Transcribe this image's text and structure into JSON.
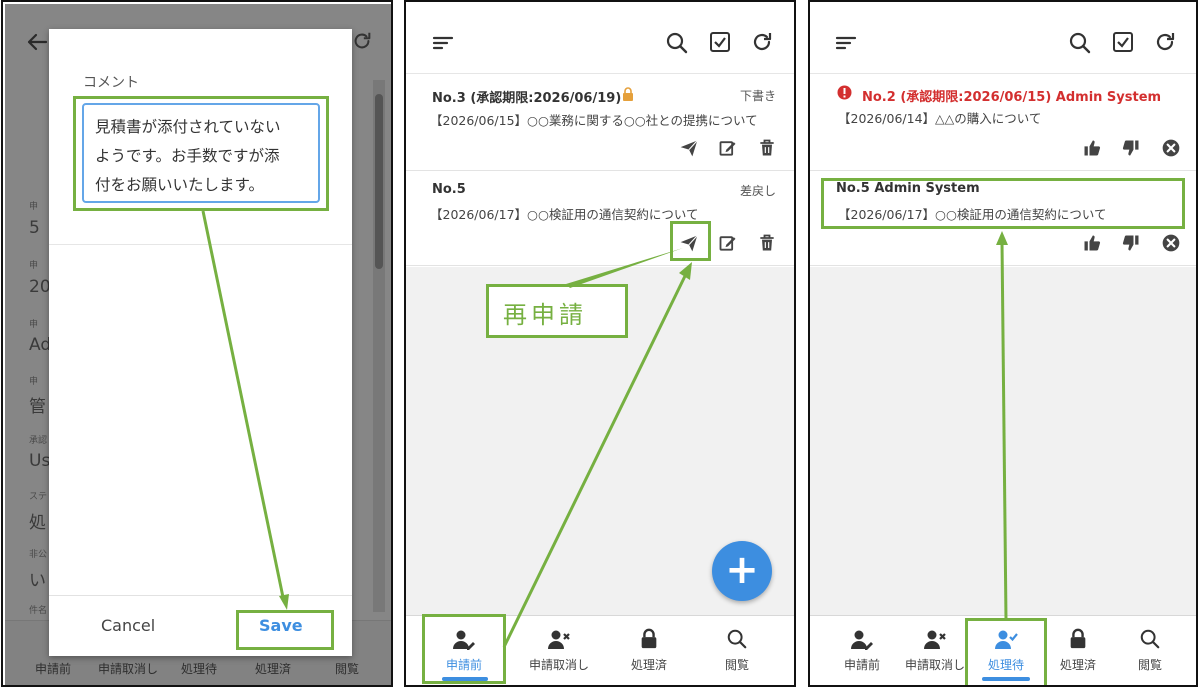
{
  "panel1": {
    "dialog": {
      "label": "コメント",
      "comment_lines": [
        "見積書が添付されていない",
        "ようです。お手数ですが添",
        "付をお願いいたします。"
      ],
      "cancel": "Cancel",
      "save": "Save"
    },
    "background_values": [
      "5",
      "20",
      "Ad",
      "管",
      "Us",
      "処",
      "い"
    ],
    "background_field_labels": [
      "申",
      "申",
      "申",
      "申",
      "承認",
      "ステ",
      "非公",
      "件名"
    ]
  },
  "nav": [
    "申請前",
    "申請取消し",
    "処理待",
    "処理済",
    "閲覧"
  ],
  "panel2": {
    "items": [
      {
        "title": "No.3 (承認期限:2026/06/19)",
        "status": "下書き",
        "subtitle": "【2026/06/15】○○業務に関する○○社との提携について"
      },
      {
        "title": "No.5",
        "status": "差戻し",
        "subtitle": "【2026/06/17】○○検証用の通信契約について"
      }
    ],
    "callout": "再申請",
    "fab": "+",
    "active_nav": "申請前"
  },
  "panel3": {
    "items": [
      {
        "title": "No.2 (承認期限:2026/06/15) Admin System",
        "subtitle": "【2026/06/14】△△の購入について",
        "overdue": true
      },
      {
        "title": "No.5 Admin System",
        "subtitle": "【2026/06/17】○○検証用の通信契約について",
        "overdue": false
      }
    ],
    "active_nav": "処理待"
  },
  "colors": {
    "accent": "#3d8ee0",
    "highlight": "#76b041",
    "overdue": "#d32f2f"
  }
}
